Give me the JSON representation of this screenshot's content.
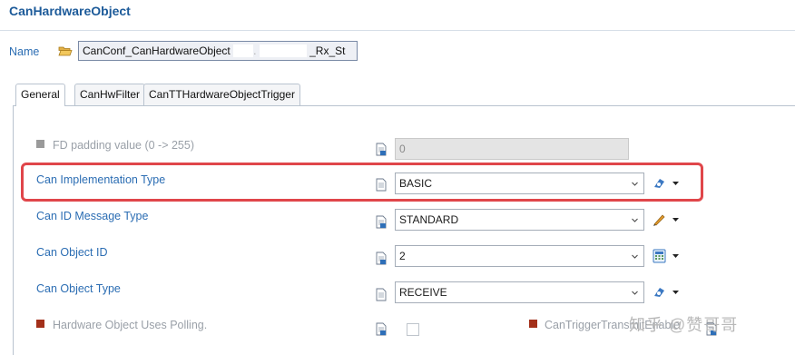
{
  "header": {
    "title": "CanHardwareObject"
  },
  "name_row": {
    "label": "Name",
    "value_prefix": "CanConf_CanHardwareObject",
    "value_suffix": "_Rx_St"
  },
  "tabs": [
    {
      "label": "General",
      "active": true
    },
    {
      "label": "CanHwFilter",
      "active": false
    },
    {
      "label": "CanTTHardwareObjectTrigger",
      "active": false
    }
  ],
  "rows": {
    "fd_padding": {
      "label": "FD padding value (0 -> 255)",
      "value": "0",
      "enabled": false
    },
    "impl_type": {
      "label": "Can Implementation Type",
      "value": "BASIC"
    },
    "id_msg_type": {
      "label": "Can ID Message Type",
      "value": "STANDARD"
    },
    "object_id": {
      "label": "Can Object ID",
      "value": "2"
    },
    "object_type": {
      "label": "Can Object Type",
      "value": "RECEIVE"
    },
    "uses_polling": {
      "label": "Hardware Object Uses Polling.",
      "checked": false,
      "enabled": false
    },
    "trigger_transmit": {
      "label": "CanTriggerTransmitEnable",
      "enabled": false
    }
  },
  "watermark": "知乎 @赞哥哥",
  "colors": {
    "link_blue": "#2b6db3",
    "title_blue": "#1c5a99",
    "highlight_red": "#e0464a"
  },
  "icons": [
    "folder-open-icon",
    "document-icon",
    "calculator-icon",
    "pencil-icon",
    "gear-arrow-icon",
    "dropdown-arrow-icon"
  ]
}
